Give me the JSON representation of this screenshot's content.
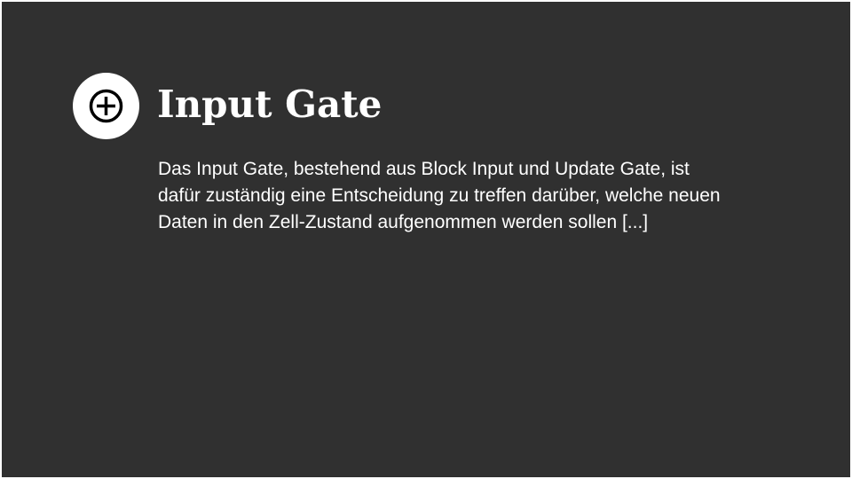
{
  "slide": {
    "icon": "circled-plus-icon",
    "title": "Input Gate",
    "body_lines": [
      "Das Input Gate, bestehend aus Block Input und Update Gate, ist",
      "dafür zuständig eine Entscheidung zu treffen darüber, welche neuen",
      "Daten in den Zell-Zustand aufgenommen werden sollen [...]"
    ]
  },
  "colors": {
    "background": "#303030",
    "text": "#ffffff",
    "icon_bg": "#ffffff",
    "icon_fg": "#000000"
  }
}
